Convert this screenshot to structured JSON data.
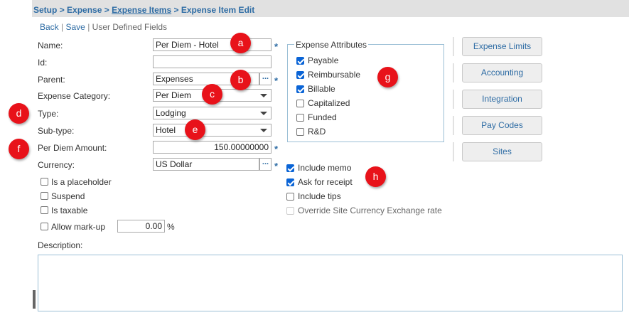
{
  "breadcrumb": {
    "items": [
      "Setup",
      "Expense",
      "Expense Items",
      "Expense Item Edit"
    ],
    "separator": ">"
  },
  "toolbar": {
    "back": "Back",
    "save": "Save",
    "user_defined": "User Defined Fields",
    "divider": "|"
  },
  "form": {
    "name_label": "Name:",
    "name_value": "Per Diem - Hotel",
    "id_label": "Id:",
    "id_value": "",
    "parent_label": "Parent:",
    "parent_value": "Expenses",
    "category_label": "Expense Category:",
    "category_value": "Per Diem",
    "type_label": "Type:",
    "type_value": "Lodging",
    "subtype_label": "Sub-type:",
    "subtype_value": "Hotel",
    "perdiem_label": "Per Diem Amount:",
    "perdiem_value": "150.00000000",
    "currency_label": "Currency:",
    "currency_value": "US Dollar",
    "required_mark": "*",
    "lookup_glyph": "..."
  },
  "options": {
    "placeholder": "Is a placeholder",
    "suspend": "Suspend",
    "taxable": "Is taxable",
    "markup": "Allow mark-up",
    "markup_value": "0.00",
    "markup_unit": "%"
  },
  "attributes": {
    "legend": "Expense Attributes",
    "items": [
      {
        "label": "Payable",
        "checked": true
      },
      {
        "label": "Reimbursable",
        "checked": true
      },
      {
        "label": "Billable",
        "checked": true
      },
      {
        "label": "Capitalized",
        "checked": false
      },
      {
        "label": "Funded",
        "checked": false
      },
      {
        "label": "R&D",
        "checked": false
      }
    ]
  },
  "extras": {
    "memo": "Include memo",
    "receipt": "Ask for receipt",
    "tips": "Include tips",
    "override": "Override Site Currency Exchange rate"
  },
  "description_label": "Description:",
  "side_buttons": [
    "Expense Limits",
    "Accounting",
    "Integration",
    "Pay Codes",
    "Sites"
  ],
  "badges": [
    "a",
    "b",
    "c",
    "d",
    "e",
    "f",
    "g",
    "h"
  ],
  "colors": {
    "link": "#2e6ca4",
    "badge": "#e8121a",
    "checkbox": "#0a64d6"
  }
}
